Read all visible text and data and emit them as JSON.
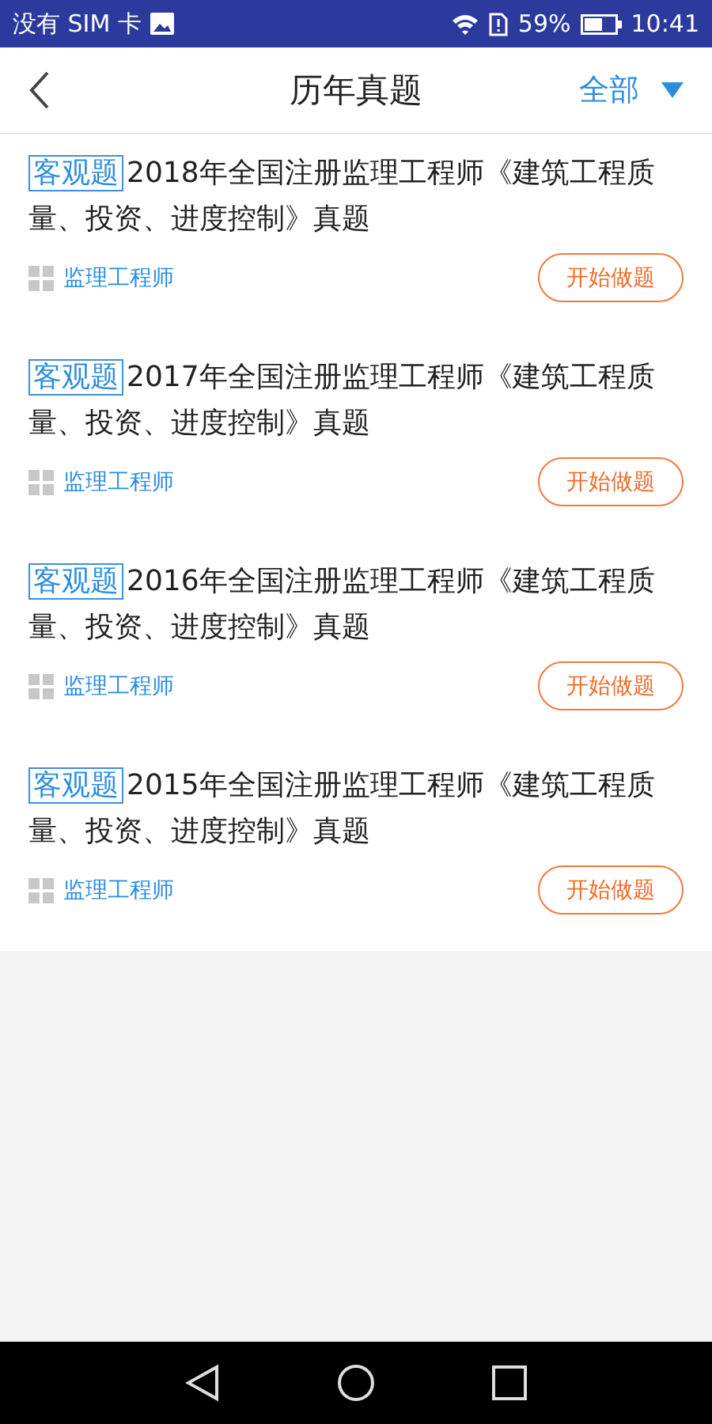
{
  "status_bar": {
    "carrier": "没有 SIM 卡",
    "battery": "59%",
    "time": "10:41"
  },
  "header": {
    "title": "历年真题",
    "filter": "全部"
  },
  "papers": [
    {
      "tag": "客观题",
      "title": "2018年全国注册监理工程师《建筑工程质量、投资、进度控制》真题",
      "category": "监理工程师",
      "action": "开始做题"
    },
    {
      "tag": "客观题",
      "title": "2017年全国注册监理工程师《建筑工程质量、投资、进度控制》真题",
      "category": "监理工程师",
      "action": "开始做题"
    },
    {
      "tag": "客观题",
      "title": "2016年全国注册监理工程师《建筑工程质量、投资、进度控制》真题",
      "category": "监理工程师",
      "action": "开始做题"
    },
    {
      "tag": "客观题",
      "title": "2015年全国注册监理工程师《建筑工程质量、投资、进度控制》真题",
      "category": "监理工程师",
      "action": "开始做题"
    }
  ]
}
